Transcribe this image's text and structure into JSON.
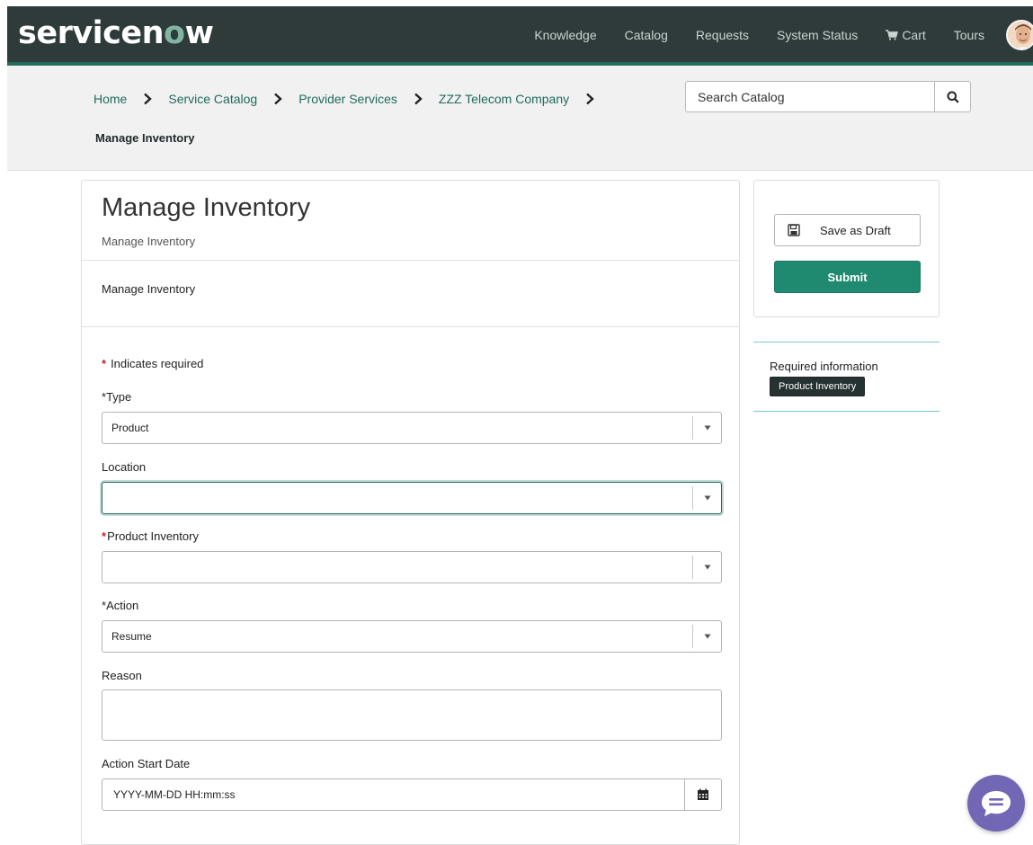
{
  "header": {
    "logo": "servicenow",
    "nav": [
      "Knowledge",
      "Catalog",
      "Requests",
      "System Status",
      "Cart",
      "Tours"
    ]
  },
  "breadcrumb": {
    "items": [
      "Home",
      "Service Catalog",
      "Provider Services",
      "ZZZ Telecom Company"
    ],
    "current": "Manage Inventory"
  },
  "search": {
    "placeholder": "Search Catalog"
  },
  "form": {
    "title": "Manage Inventory",
    "subtitle": "Manage Inventory",
    "description": "Manage Inventory",
    "required_note": "Indicates required",
    "required_marker": "*",
    "fields": {
      "type": {
        "label": "Type",
        "value": "Product"
      },
      "location": {
        "label": "Location",
        "value": ""
      },
      "product_inventory": {
        "label": "Product Inventory",
        "value": ""
      },
      "action": {
        "label": "Action",
        "value": "Resume"
      },
      "reason": {
        "label": "Reason",
        "value": ""
      },
      "action_start_date": {
        "label": "Action Start Date",
        "placeholder": "YYYY-MM-DD HH:mm:ss"
      }
    }
  },
  "side": {
    "save_draft_label": "Save as Draft",
    "submit_label": "Submit",
    "required_info_title": "Required information",
    "required_info_badge": "Product Inventory"
  },
  "colors": {
    "header_bg": "#2f3b3b",
    "brand_green": "#1f8a70",
    "link": "#1f6b5c",
    "required": "#c0282b",
    "chat": "#7167b5"
  }
}
